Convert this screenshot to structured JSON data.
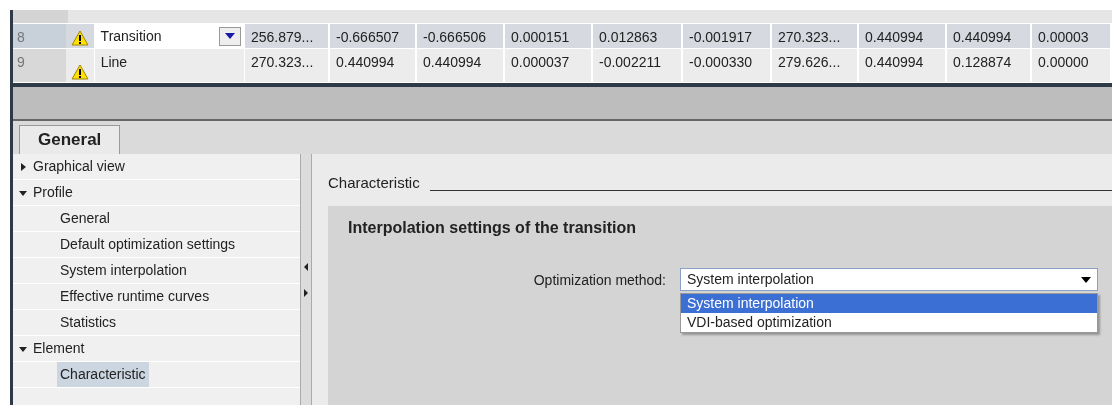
{
  "table": {
    "rows": [
      {
        "number": "8",
        "warning": true,
        "name": "Transition",
        "editing": true,
        "selected": true,
        "values": [
          "256.879...",
          "-0.666507",
          "-0.666506",
          "0.000151",
          "0.012863",
          "-0.001917",
          "270.323...",
          "0.440994",
          "0.440994",
          "0.00003"
        ]
      },
      {
        "number": "9",
        "warning": true,
        "name": "Line",
        "editing": false,
        "selected": false,
        "values": [
          "270.323...",
          "0.440994",
          "0.440994",
          "0.000037",
          "-0.002211",
          "-0.000330",
          "279.626...",
          "0.440994",
          "0.128874",
          "0.00000"
        ]
      }
    ]
  },
  "tabs": [
    {
      "label": "General",
      "selected": true
    }
  ],
  "tree": [
    {
      "label": "Graphical view",
      "expanded": false,
      "selected": false
    },
    {
      "label": "Profile",
      "expanded": true,
      "selected": false,
      "children": [
        {
          "label": "General",
          "selected": false
        },
        {
          "label": "Default optimization settings",
          "selected": false
        },
        {
          "label": "System interpolation",
          "selected": false
        },
        {
          "label": "Effective runtime curves",
          "selected": false
        },
        {
          "label": "Statistics",
          "selected": false
        }
      ]
    },
    {
      "label": "Element",
      "expanded": true,
      "selected": false,
      "children": [
        {
          "label": "Characteristic",
          "selected": true
        }
      ]
    }
  ],
  "section": {
    "title": "Characteristic",
    "group_title": "Interpolation settings of the transition",
    "field_label": "Optimization method:",
    "field_value": "System interpolation",
    "dropdown_open": true,
    "options": [
      {
        "label": "System interpolation",
        "selected": true
      },
      {
        "label": "VDI-based optimization",
        "selected": false
      }
    ]
  }
}
